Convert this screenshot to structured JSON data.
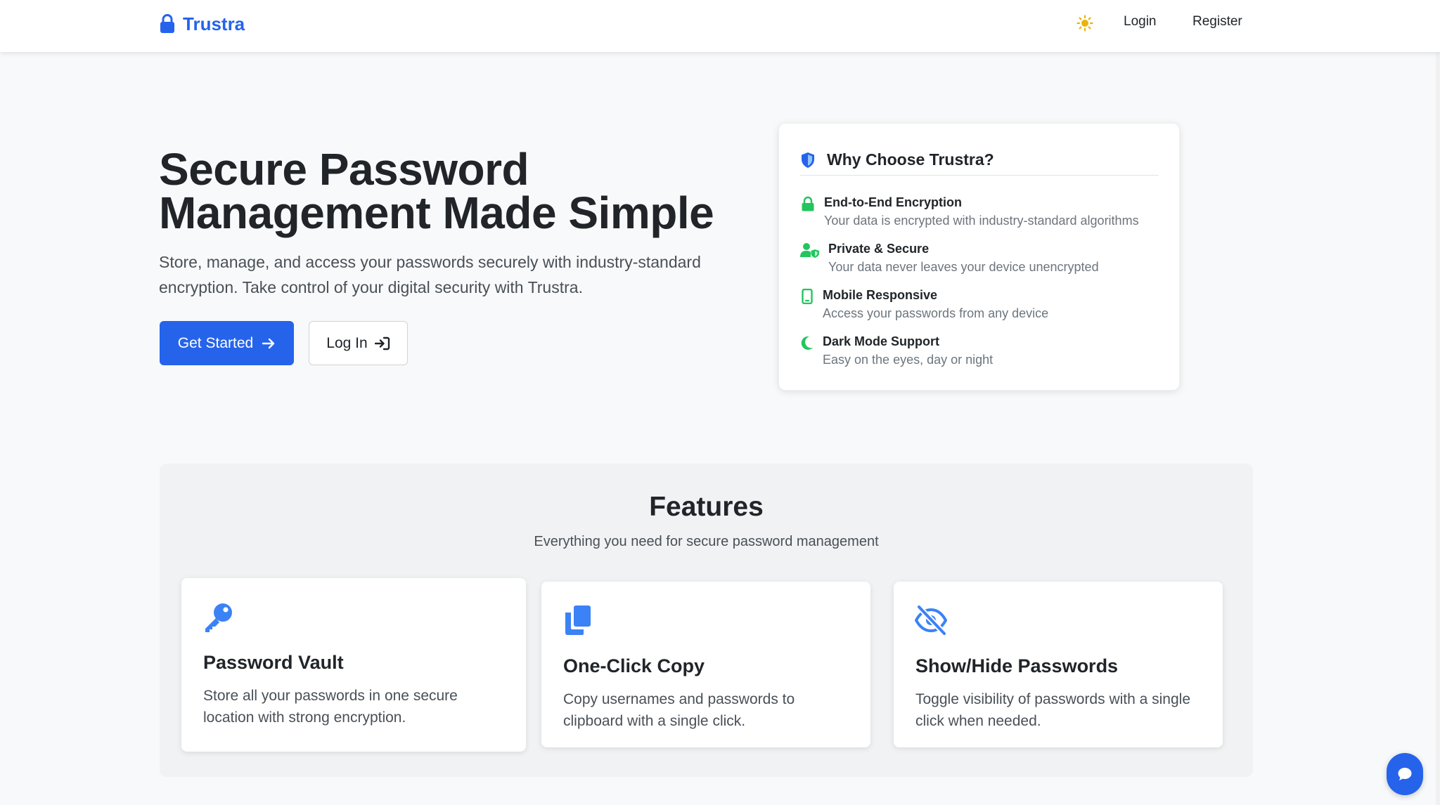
{
  "nav": {
    "brand": "Trustra",
    "login": "Login",
    "register": "Register",
    "icons": {
      "brand": "lock-icon",
      "theme": "sun-icon"
    }
  },
  "hero": {
    "title": "Secure Password Management Made Simple",
    "subtitle": "Store, manage, and access your passwords securely with industry-standard encryption. Take control of your digital security with Trustra.",
    "get_started": "Get Started",
    "log_in": "Log In"
  },
  "why": {
    "title": "Why Choose Trustra?",
    "items": [
      {
        "title": "End-to-End Encryption",
        "desc": "Your data is encrypted with industry-standard algorithms",
        "icon": "lock-icon"
      },
      {
        "title": "Private & Secure",
        "desc": "Your data never leaves your device unencrypted",
        "icon": "user-shield-icon"
      },
      {
        "title": "Mobile Responsive",
        "desc": "Access your passwords from any device",
        "icon": "mobile-icon"
      },
      {
        "title": "Dark Mode Support",
        "desc": "Easy on the eyes, day or night",
        "icon": "moon-icon"
      }
    ]
  },
  "features": {
    "title": "Features",
    "subtitle": "Everything you need for secure password management",
    "cards": [
      {
        "title": "Password Vault",
        "desc": "Store all your passwords in one secure location with strong encryption.",
        "icon": "key-icon"
      },
      {
        "title": "One-Click Copy",
        "desc": "Copy usernames and passwords to clipboard with a single click.",
        "icon": "copy-icon"
      },
      {
        "title": "Show/Hide Passwords",
        "desc": "Toggle visibility of passwords with a single click when needed.",
        "icon": "eye-slash-icon"
      }
    ]
  },
  "colors": {
    "primary": "#2563eb",
    "accent_green": "#22c55e",
    "sun": "#eab308",
    "text": "#212529",
    "muted": "#6c757d"
  }
}
